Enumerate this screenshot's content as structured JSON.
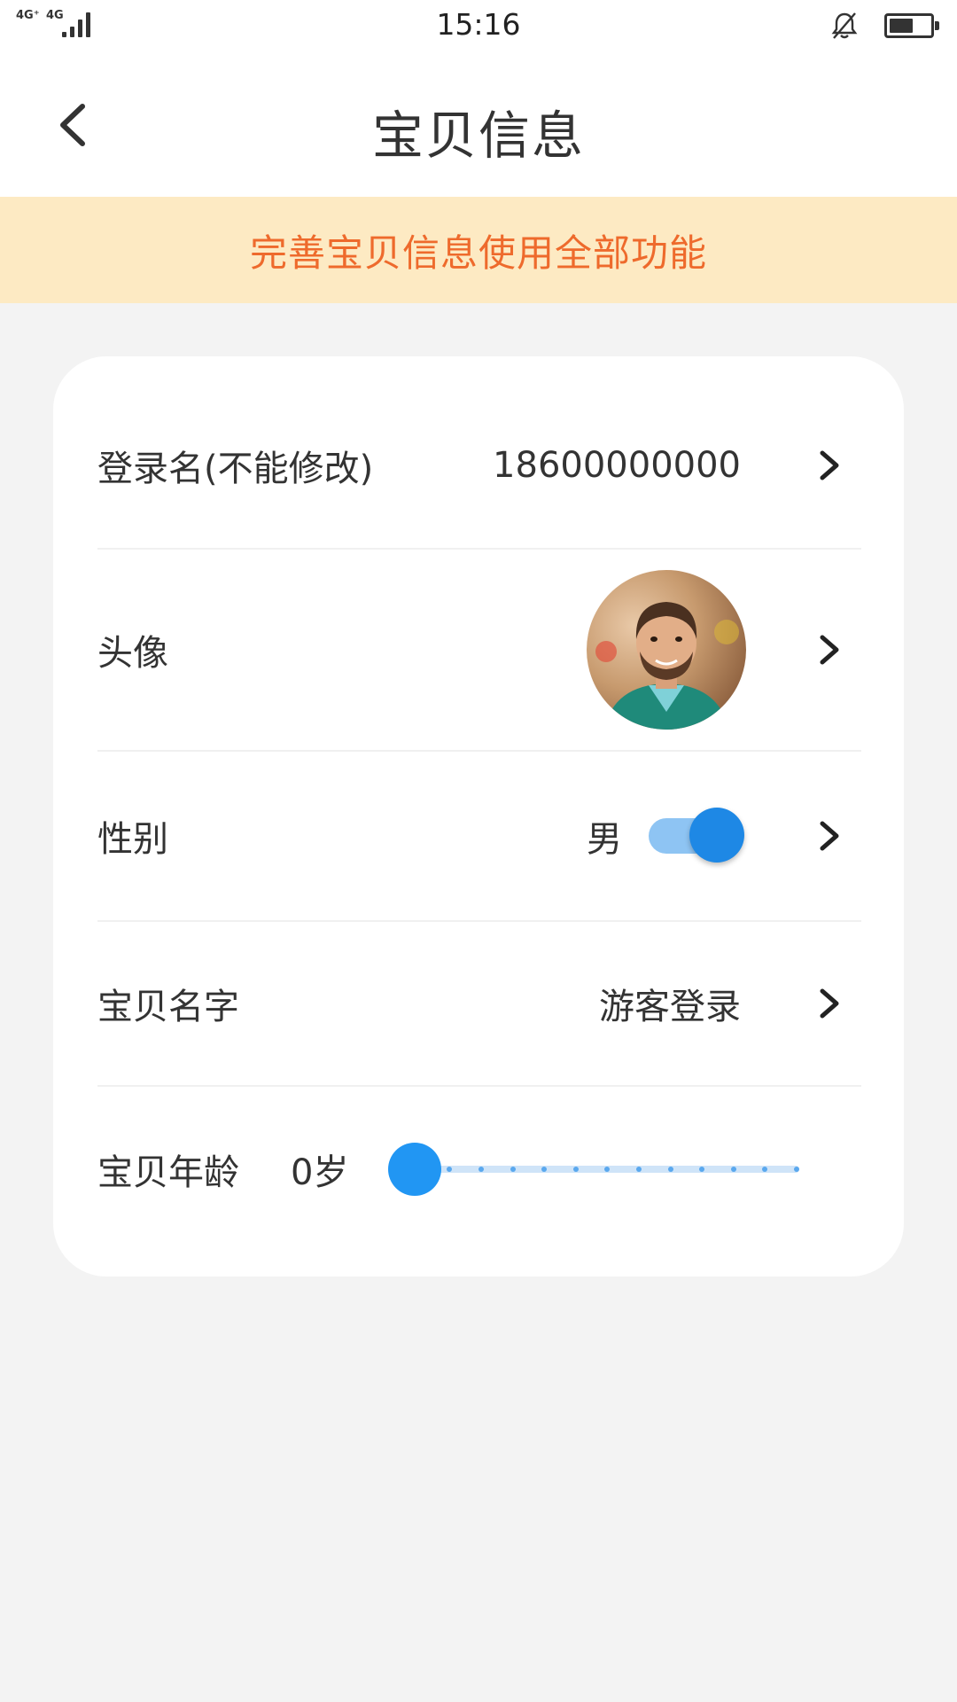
{
  "status_bar": {
    "network_1": "4G⁺",
    "network_2": "4G",
    "time": "15:16",
    "battery_level": 0.6
  },
  "nav": {
    "title": "宝贝信息"
  },
  "notice": {
    "text": "完善宝贝信息使用全部功能"
  },
  "profile": {
    "login": {
      "label": "登录名(不能修改)",
      "value": "18600000000"
    },
    "avatar": {
      "label": "头像"
    },
    "gender": {
      "label": "性别",
      "value": "男",
      "toggle_on": true
    },
    "name": {
      "label": "宝贝名字",
      "value": "游客登录"
    },
    "age": {
      "label": "宝贝年龄",
      "value": "0岁",
      "slider_position": 0
    }
  },
  "colors": {
    "accent": "#1e88e5",
    "notice_bg": "#fdeac3",
    "notice_text": "#ee6a2c",
    "page_bg": "#f3f3f3"
  }
}
